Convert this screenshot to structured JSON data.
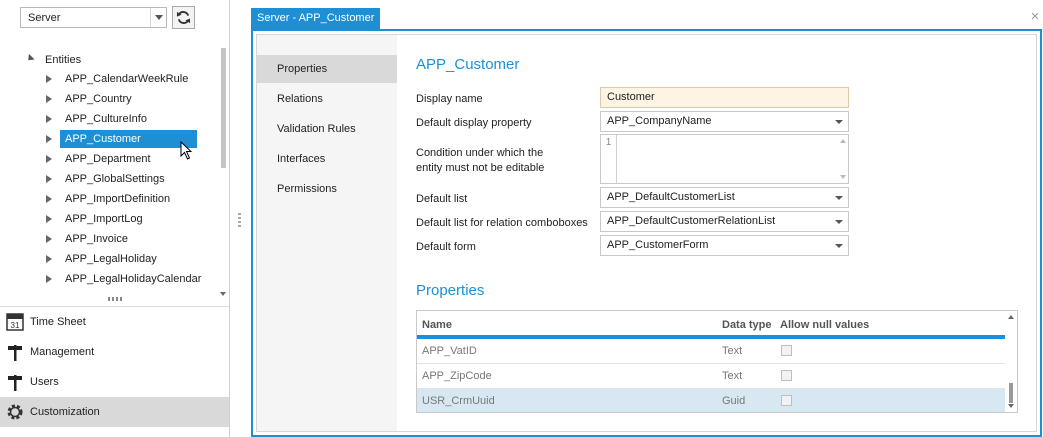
{
  "server": {
    "selected": "Server"
  },
  "tree": {
    "root_label": "Entities",
    "items": [
      {
        "label": "APP_CalendarWeekRule"
      },
      {
        "label": "APP_Country"
      },
      {
        "label": "APP_CultureInfo"
      },
      {
        "label": "APP_Customer",
        "selected": true
      },
      {
        "label": "APP_Department"
      },
      {
        "label": "APP_GlobalSettings"
      },
      {
        "label": "APP_ImportDefinition"
      },
      {
        "label": "APP_ImportLog"
      },
      {
        "label": "APP_Invoice"
      },
      {
        "label": "APP_LegalHoliday"
      },
      {
        "label": "APP_LegalHolidayCalendar"
      }
    ]
  },
  "nav": {
    "items": [
      {
        "label": "Time Sheet",
        "icon": "calendar-icon"
      },
      {
        "label": "Management",
        "icon": "signpost-icon"
      },
      {
        "label": "Users",
        "icon": "signpost-icon"
      },
      {
        "label": "Customization",
        "icon": "gear-icon",
        "active": true
      }
    ]
  },
  "window": {
    "tab_title": "Server - APP_Customer",
    "side_items": [
      {
        "label": "Properties",
        "active": true
      },
      {
        "label": "Relations"
      },
      {
        "label": "Validation Rules"
      },
      {
        "label": "Interfaces"
      },
      {
        "label": "Permissions"
      }
    ]
  },
  "form": {
    "title": "APP_Customer",
    "display_name_label": "Display name",
    "display_name_value": "Customer",
    "default_display_property_label": "Default display property",
    "default_display_property_value": "APP_CompanyName",
    "condition_label_line1": "Condition under which the",
    "condition_label_line2": "entity must not be editable",
    "condition_line_number": "1",
    "default_list_label": "Default list",
    "default_list_value": "APP_DefaultCustomerList",
    "default_list_relation_label": "Default list for relation comboboxes",
    "default_list_relation_value": "APP_DefaultCustomerRelationList",
    "default_form_label": "Default form",
    "default_form_value": "APP_CustomerForm"
  },
  "properties": {
    "title": "Properties",
    "columns": {
      "name": "Name",
      "data_type": "Data type",
      "allow_null": "Allow null values"
    },
    "rows": [
      {
        "name": "APP_VatID",
        "data_type": "Text",
        "allow_null": false
      },
      {
        "name": "APP_ZipCode",
        "data_type": "Text",
        "allow_null": false
      },
      {
        "name": "USR_CrmUuid",
        "data_type": "Guid",
        "allow_null": false,
        "selected": true
      }
    ]
  },
  "colors": {
    "accent": "#1e8fd4",
    "selection_row": "#d7e8f2",
    "active_nav": "#d9d9d9",
    "display_name_bg": "#fdf4e4"
  }
}
